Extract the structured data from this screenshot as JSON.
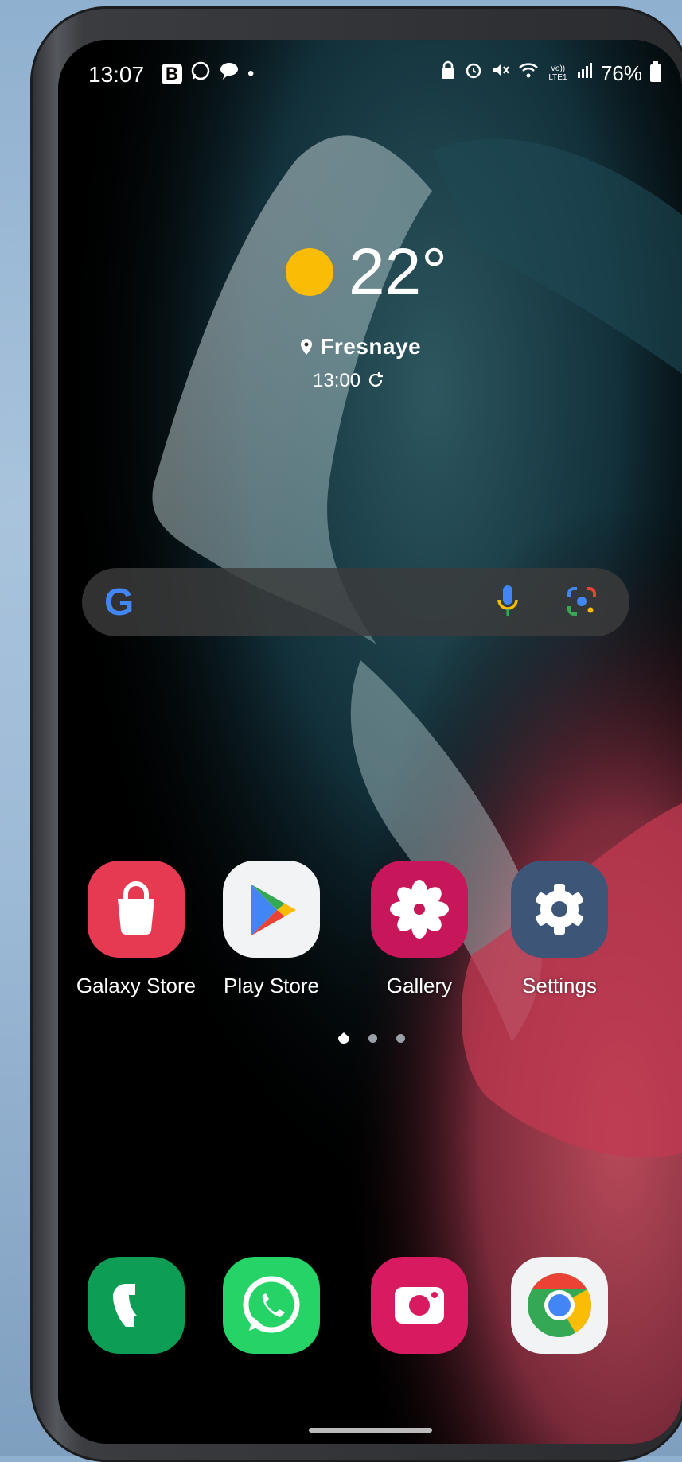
{
  "status_bar": {
    "time": "13:07",
    "left_icons": [
      "b-badge-icon",
      "whatsapp-icon",
      "chat-icon",
      "dot-icon"
    ],
    "right_icons": [
      "lock-icon",
      "alarm-icon",
      "mute-icon",
      "wifi-icon",
      "volte-icon",
      "signal-icon"
    ],
    "volte_label": "Vo)) LTE1",
    "battery": "76%"
  },
  "weather": {
    "temperature": "22°",
    "location": "Fresnaye",
    "updated_time": "13:00"
  },
  "search": {
    "logo": "G",
    "icons": [
      "google-logo-icon",
      "mic-icon",
      "lens-icon"
    ]
  },
  "apps": [
    {
      "label": "Galaxy Store",
      "color": "#e63952",
      "icon": "shopping-bag-icon"
    },
    {
      "label": "Play Store",
      "color": "#f1f3f4",
      "icon": "play-store-icon"
    },
    {
      "label": "Gallery",
      "color": "#c8165b",
      "icon": "flower-icon"
    },
    {
      "label": "Settings",
      "color": "#3d5678",
      "icon": "gear-icon"
    }
  ],
  "dock": [
    {
      "name": "phone",
      "color": "#0e9d54",
      "icon": "phone-icon"
    },
    {
      "name": "whatsapp",
      "color": "#25d366",
      "icon": "whatsapp-icon"
    },
    {
      "name": "camera",
      "color": "#d81b60",
      "icon": "camera-icon"
    },
    {
      "name": "chrome",
      "color": "#f1f3f4",
      "icon": "chrome-icon"
    }
  ],
  "page_indicator": {
    "pages": 3,
    "current": 1
  }
}
